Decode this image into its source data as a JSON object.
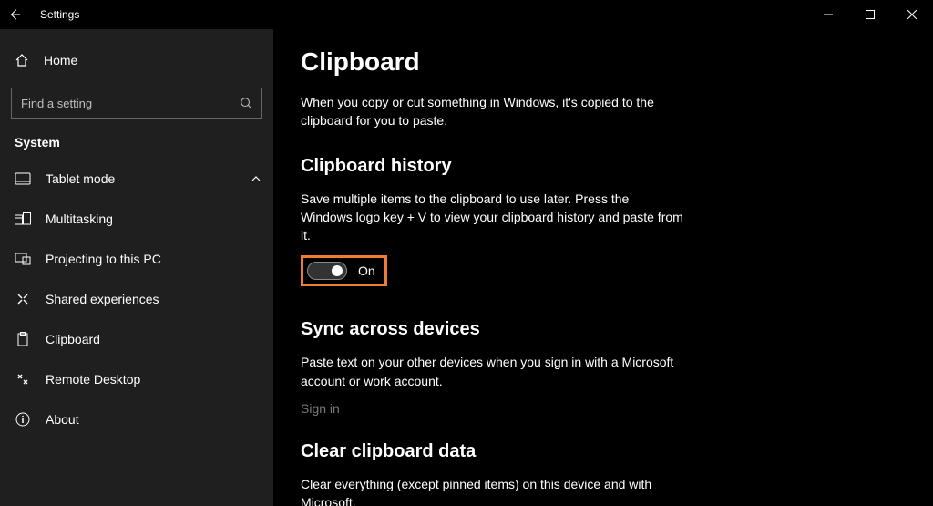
{
  "titlebar": {
    "title": "Settings"
  },
  "sidebar": {
    "home": "Home",
    "search_placeholder": "Find a setting",
    "category": "System",
    "items": [
      {
        "label": "Tablet mode",
        "chevron": true
      },
      {
        "label": "Multitasking"
      },
      {
        "label": "Projecting to this PC"
      },
      {
        "label": "Shared experiences"
      },
      {
        "label": "Clipboard"
      },
      {
        "label": "Remote Desktop"
      },
      {
        "label": "About"
      }
    ]
  },
  "main": {
    "title": "Clipboard",
    "intro": "When you copy or cut something in Windows, it's copied to the clipboard for you to paste.",
    "history": {
      "heading": "Clipboard history",
      "desc": "Save multiple items to the clipboard to use later. Press the Windows logo key + V to view your clipboard history and paste from it.",
      "toggle_state": "On",
      "highlight_color": "#ed7d31"
    },
    "sync": {
      "heading": "Sync across devices",
      "desc": "Paste text on your other devices when you sign in with a Microsoft account or work account.",
      "signin": "Sign in"
    },
    "clear": {
      "heading": "Clear clipboard data",
      "desc": "Clear everything (except pinned items) on this device and with Microsoft."
    }
  }
}
